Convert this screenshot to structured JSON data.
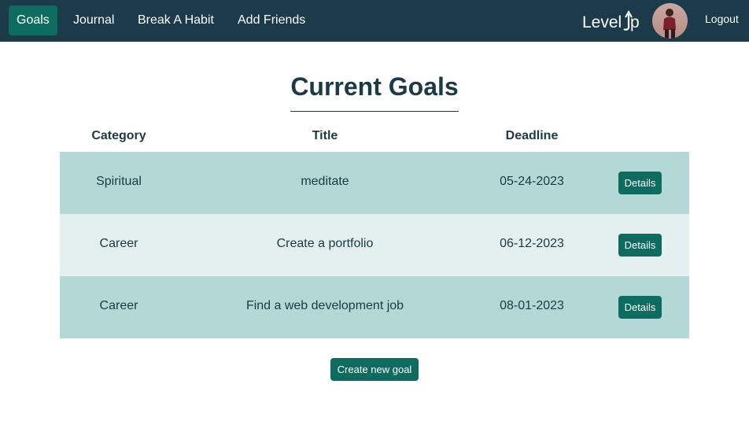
{
  "nav": {
    "links": [
      {
        "label": "Goals",
        "active": true
      },
      {
        "label": "Journal",
        "active": false
      },
      {
        "label": "Break A Habit",
        "active": false
      },
      {
        "label": "Add Friends",
        "active": false
      }
    ],
    "logo_text_left": "Level",
    "logo_text_right": "p",
    "avatar_icon": "user-avatar-photo",
    "logout_label": "Logout"
  },
  "main": {
    "title": "Current Goals",
    "table": {
      "headers": [
        "Category",
        "Title",
        "Deadline"
      ],
      "rows": [
        {
          "category": "Spiritual",
          "title": "meditate",
          "deadline": "05-24-2023",
          "action": "Details"
        },
        {
          "category": "Career",
          "title": "Create a portfolio",
          "deadline": "06-12-2023",
          "action": "Details"
        },
        {
          "category": "Career",
          "title": "Find a web development job",
          "deadline": "08-01-2023",
          "action": "Details"
        }
      ]
    },
    "create_label": "Create new goal"
  },
  "colors": {
    "navbar": "#1b3a4a",
    "accent": "#0e6b60",
    "row_dark": "#b4d8d5",
    "row_light": "#e3f0ef",
    "text": "#1b3a45"
  }
}
